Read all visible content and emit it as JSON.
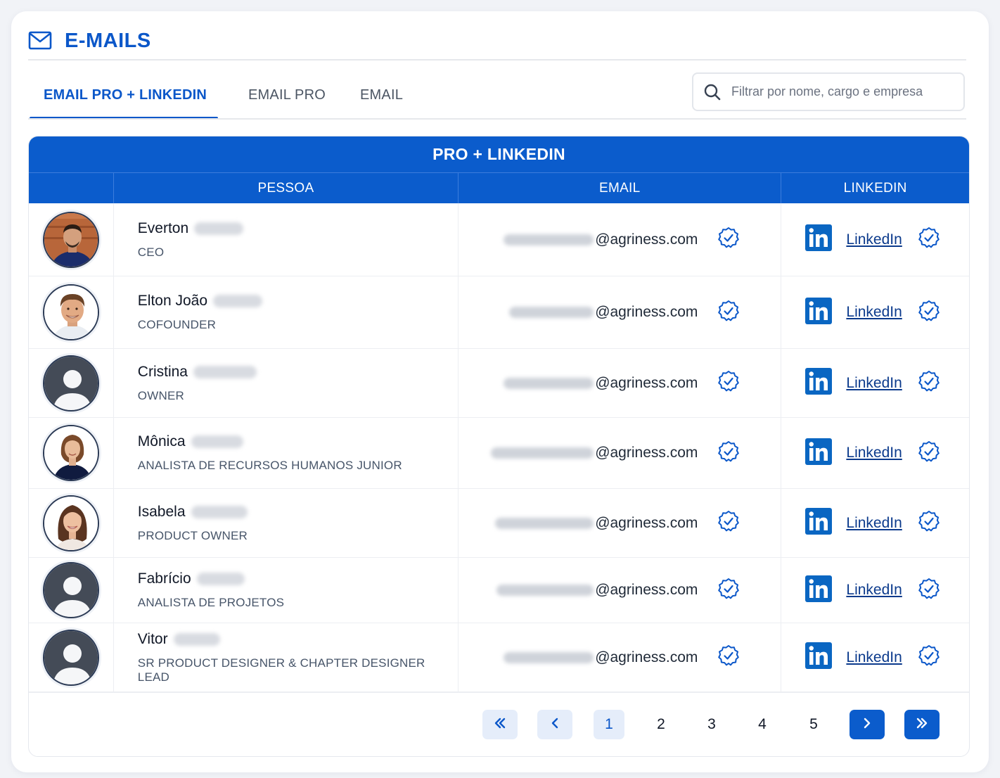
{
  "header": {
    "title": "E-MAILS",
    "icon": "mail-icon"
  },
  "tabs": [
    {
      "label": "EMAIL PRO + LINKEDIN",
      "active": true
    },
    {
      "label": "EMAIL PRO",
      "active": false
    },
    {
      "label": "EMAIL",
      "active": false
    }
  ],
  "search": {
    "placeholder": "Filtrar por nome, cargo e empresa",
    "icon": "search-icon"
  },
  "table": {
    "title": "PRO + LINKEDIN",
    "columns": [
      "",
      "PESSOA",
      "EMAIL",
      "LINKEDIN"
    ],
    "rows": [
      {
        "first_name": "Everton",
        "role": "CEO",
        "email_domain": "@agriness.com",
        "linkedin_label": "LinkedIn",
        "avatar": "photo",
        "email_verified": true,
        "linkedin_verified": true
      },
      {
        "first_name": "Elton João",
        "role": "COFOUNDER",
        "email_domain": "@agriness.com",
        "linkedin_label": "LinkedIn",
        "avatar": "photo",
        "email_verified": true,
        "linkedin_verified": true
      },
      {
        "first_name": "Cristina",
        "role": "OWNER",
        "email_domain": "@agriness.com",
        "linkedin_label": "LinkedIn",
        "avatar": "placeholder",
        "email_verified": true,
        "linkedin_verified": true
      },
      {
        "first_name": "Mônica",
        "role": "ANALISTA DE RECURSOS HUMANOS JUNIOR",
        "email_domain": "@agriness.com",
        "linkedin_label": "LinkedIn",
        "avatar": "photo",
        "email_verified": true,
        "linkedin_verified": true
      },
      {
        "first_name": "Isabela",
        "role": "PRODUCT OWNER",
        "email_domain": "@agriness.com",
        "linkedin_label": "LinkedIn",
        "avatar": "photo",
        "email_verified": true,
        "linkedin_verified": true
      },
      {
        "first_name": "Fabrício",
        "role": "ANALISTA DE PROJETOS",
        "email_domain": "@agriness.com",
        "linkedin_label": "LinkedIn",
        "avatar": "placeholder",
        "email_verified": true,
        "linkedin_verified": true
      },
      {
        "first_name": "Vitor",
        "role": "SR PRODUCT DESIGNER & CHAPTER DESIGNER LEAD",
        "email_domain": "@agriness.com",
        "linkedin_label": "LinkedIn",
        "avatar": "placeholder",
        "email_verified": true,
        "linkedin_verified": true
      }
    ]
  },
  "pagination": {
    "pages": [
      "1",
      "2",
      "3",
      "4",
      "5"
    ],
    "current": "1",
    "icons": [
      "double-chevron-left-icon",
      "chevron-left-icon",
      "chevron-right-icon",
      "double-chevron-right-icon"
    ]
  },
  "colors": {
    "primary": "#0b5ccc",
    "accent_text": "#0b57c9",
    "ghost_button": "#e5edfa",
    "linkedin": "#0a66c2"
  }
}
